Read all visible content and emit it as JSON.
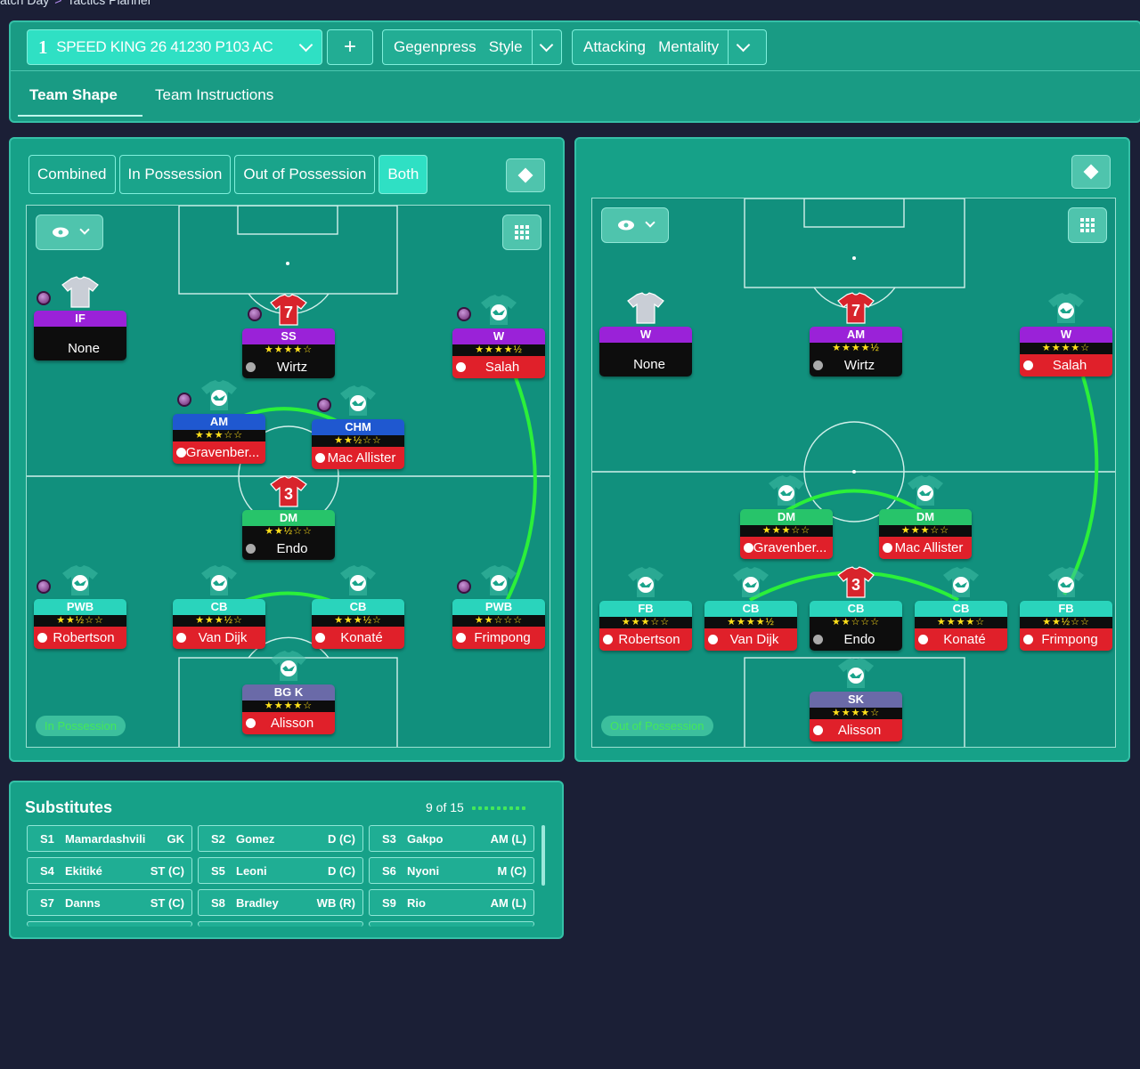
{
  "breadcrumb": {
    "first": "atch Day",
    "sep": ">",
    "second": "Tactics Planner"
  },
  "toolbar": {
    "tactic_number": "1",
    "tactic_name": "SPEED KING 26 41230 P103 AC",
    "add_label": "+",
    "style_value": "Gegenpress",
    "style_label": "Style",
    "mentality_value": "Attacking",
    "mentality_label": "Mentality"
  },
  "tabs": [
    {
      "label": "Team Shape"
    },
    {
      "label": "Team Instructions"
    }
  ],
  "shape_panel": {
    "filters": [
      "Combined",
      "In Possession",
      "Out of Possession",
      "Both"
    ],
    "active_filter": "Both"
  },
  "in_possession": {
    "label": "In Possession",
    "cards": [
      {
        "role": "IF",
        "stars": "",
        "player": "None",
        "role_color": "#9a22d8",
        "name_style": "empty",
        "kit": "grey"
      },
      {
        "role": "SS",
        "stars": "★★★★☆",
        "player": "Wirtz",
        "role_color": "#9a22d8",
        "name_style": "black",
        "kit": "red",
        "kit_number": "7"
      },
      {
        "role": "W",
        "stars": "★★★★½",
        "player": "Salah",
        "role_color": "#9a22d8",
        "name_style": "red",
        "kit": "green"
      },
      {
        "role": "AM",
        "stars": "★★★☆☆",
        "player": "Gravenber...",
        "role_color": "#1f58d0",
        "name_style": "red",
        "kit": "green"
      },
      {
        "role": "CHM",
        "stars": "★★½☆☆",
        "player": "Mac Allister",
        "role_color": "#1f58d0",
        "name_style": "red",
        "kit": "green"
      },
      {
        "role": "DM",
        "stars": "★★½☆☆",
        "player": "Endo",
        "role_color": "#27c46a",
        "name_style": "black",
        "kit": "red",
        "kit_number": "3"
      },
      {
        "role": "PWB",
        "stars": "★★½☆☆",
        "player": "Robertson",
        "role_color": "#2ad4bc",
        "name_style": "red",
        "kit": "green"
      },
      {
        "role": "CB",
        "stars": "★★★½☆",
        "player": "Van Dijk",
        "role_color": "#2ad4bc",
        "name_style": "red",
        "kit": "green"
      },
      {
        "role": "CB",
        "stars": "★★★½☆",
        "player": "Konaté",
        "role_color": "#2ad4bc",
        "name_style": "red",
        "kit": "green"
      },
      {
        "role": "PWB",
        "stars": "★★☆☆☆",
        "player": "Frimpong",
        "role_color": "#2ad4bc",
        "name_style": "red",
        "kit": "green"
      },
      {
        "role": "BG K",
        "stars": "★★★★☆",
        "player": "Alisson",
        "role_color": "#6a6aa8",
        "name_style": "red",
        "kit": "green"
      }
    ]
  },
  "out_of_possession": {
    "label": "Out of Possession",
    "cards": [
      {
        "role": "W",
        "stars": "",
        "player": "None",
        "role_color": "#9a22d8",
        "name_style": "empty",
        "kit": "grey"
      },
      {
        "role": "AM",
        "stars": "★★★★½",
        "player": "Wirtz",
        "role_color": "#9a22d8",
        "name_style": "black",
        "kit": "red",
        "kit_number": "7"
      },
      {
        "role": "W",
        "stars": "★★★★☆",
        "player": "Salah",
        "role_color": "#9a22d8",
        "name_style": "red",
        "kit": "green"
      },
      {
        "role": "DM",
        "stars": "★★★☆☆",
        "player": "Gravenber...",
        "role_color": "#27c46a",
        "name_style": "red",
        "kit": "green"
      },
      {
        "role": "DM",
        "stars": "★★★☆☆",
        "player": "Mac Allister",
        "role_color": "#27c46a",
        "name_style": "red",
        "kit": "green"
      },
      {
        "role": "FB",
        "stars": "★★★☆☆",
        "player": "Robertson",
        "role_color": "#2ad4bc",
        "name_style": "red",
        "kit": "green"
      },
      {
        "role": "CB",
        "stars": "★★★★½",
        "player": "Van Dijk",
        "role_color": "#2ad4bc",
        "name_style": "red",
        "kit": "green"
      },
      {
        "role": "CB",
        "stars": "★★☆☆☆",
        "player": "Endo",
        "role_color": "#2ad4bc",
        "name_style": "black",
        "kit": "red",
        "kit_number": "3"
      },
      {
        "role": "CB",
        "stars": "★★★★☆",
        "player": "Konaté",
        "role_color": "#2ad4bc",
        "name_style": "red",
        "kit": "green"
      },
      {
        "role": "FB",
        "stars": "★★½☆☆",
        "player": "Frimpong",
        "role_color": "#2ad4bc",
        "name_style": "red",
        "kit": "green"
      },
      {
        "role": "SK",
        "stars": "★★★★☆",
        "player": "Alisson",
        "role_color": "#6a6aa8",
        "name_style": "red",
        "kit": "green"
      }
    ]
  },
  "substitutes": {
    "title": "Substitutes",
    "count": "9 of 15",
    "selected": 9,
    "total": 15,
    "items": [
      {
        "slot": "S1",
        "name": "Mamardashvili",
        "pos": "GK"
      },
      {
        "slot": "S2",
        "name": "Gomez",
        "pos": "D (C)"
      },
      {
        "slot": "S3",
        "name": "Gakpo",
        "pos": "AM (L)"
      },
      {
        "slot": "S4",
        "name": "Ekitiké",
        "pos": "ST (C)"
      },
      {
        "slot": "S5",
        "name": "Leoni",
        "pos": "D (C)"
      },
      {
        "slot": "S6",
        "name": "Nyoni",
        "pos": "M (C)"
      },
      {
        "slot": "S7",
        "name": "Danns",
        "pos": "ST (C)"
      },
      {
        "slot": "S8",
        "name": "Bradley",
        "pos": "WB (R)"
      },
      {
        "slot": "S9",
        "name": "Rio",
        "pos": "AM (L)"
      }
    ]
  },
  "colors": {
    "accent": "#2fe0c4",
    "panel": "#16a188",
    "pitch": "#11907d",
    "link_line": "#2bf03a",
    "background": "#1b1f36"
  }
}
